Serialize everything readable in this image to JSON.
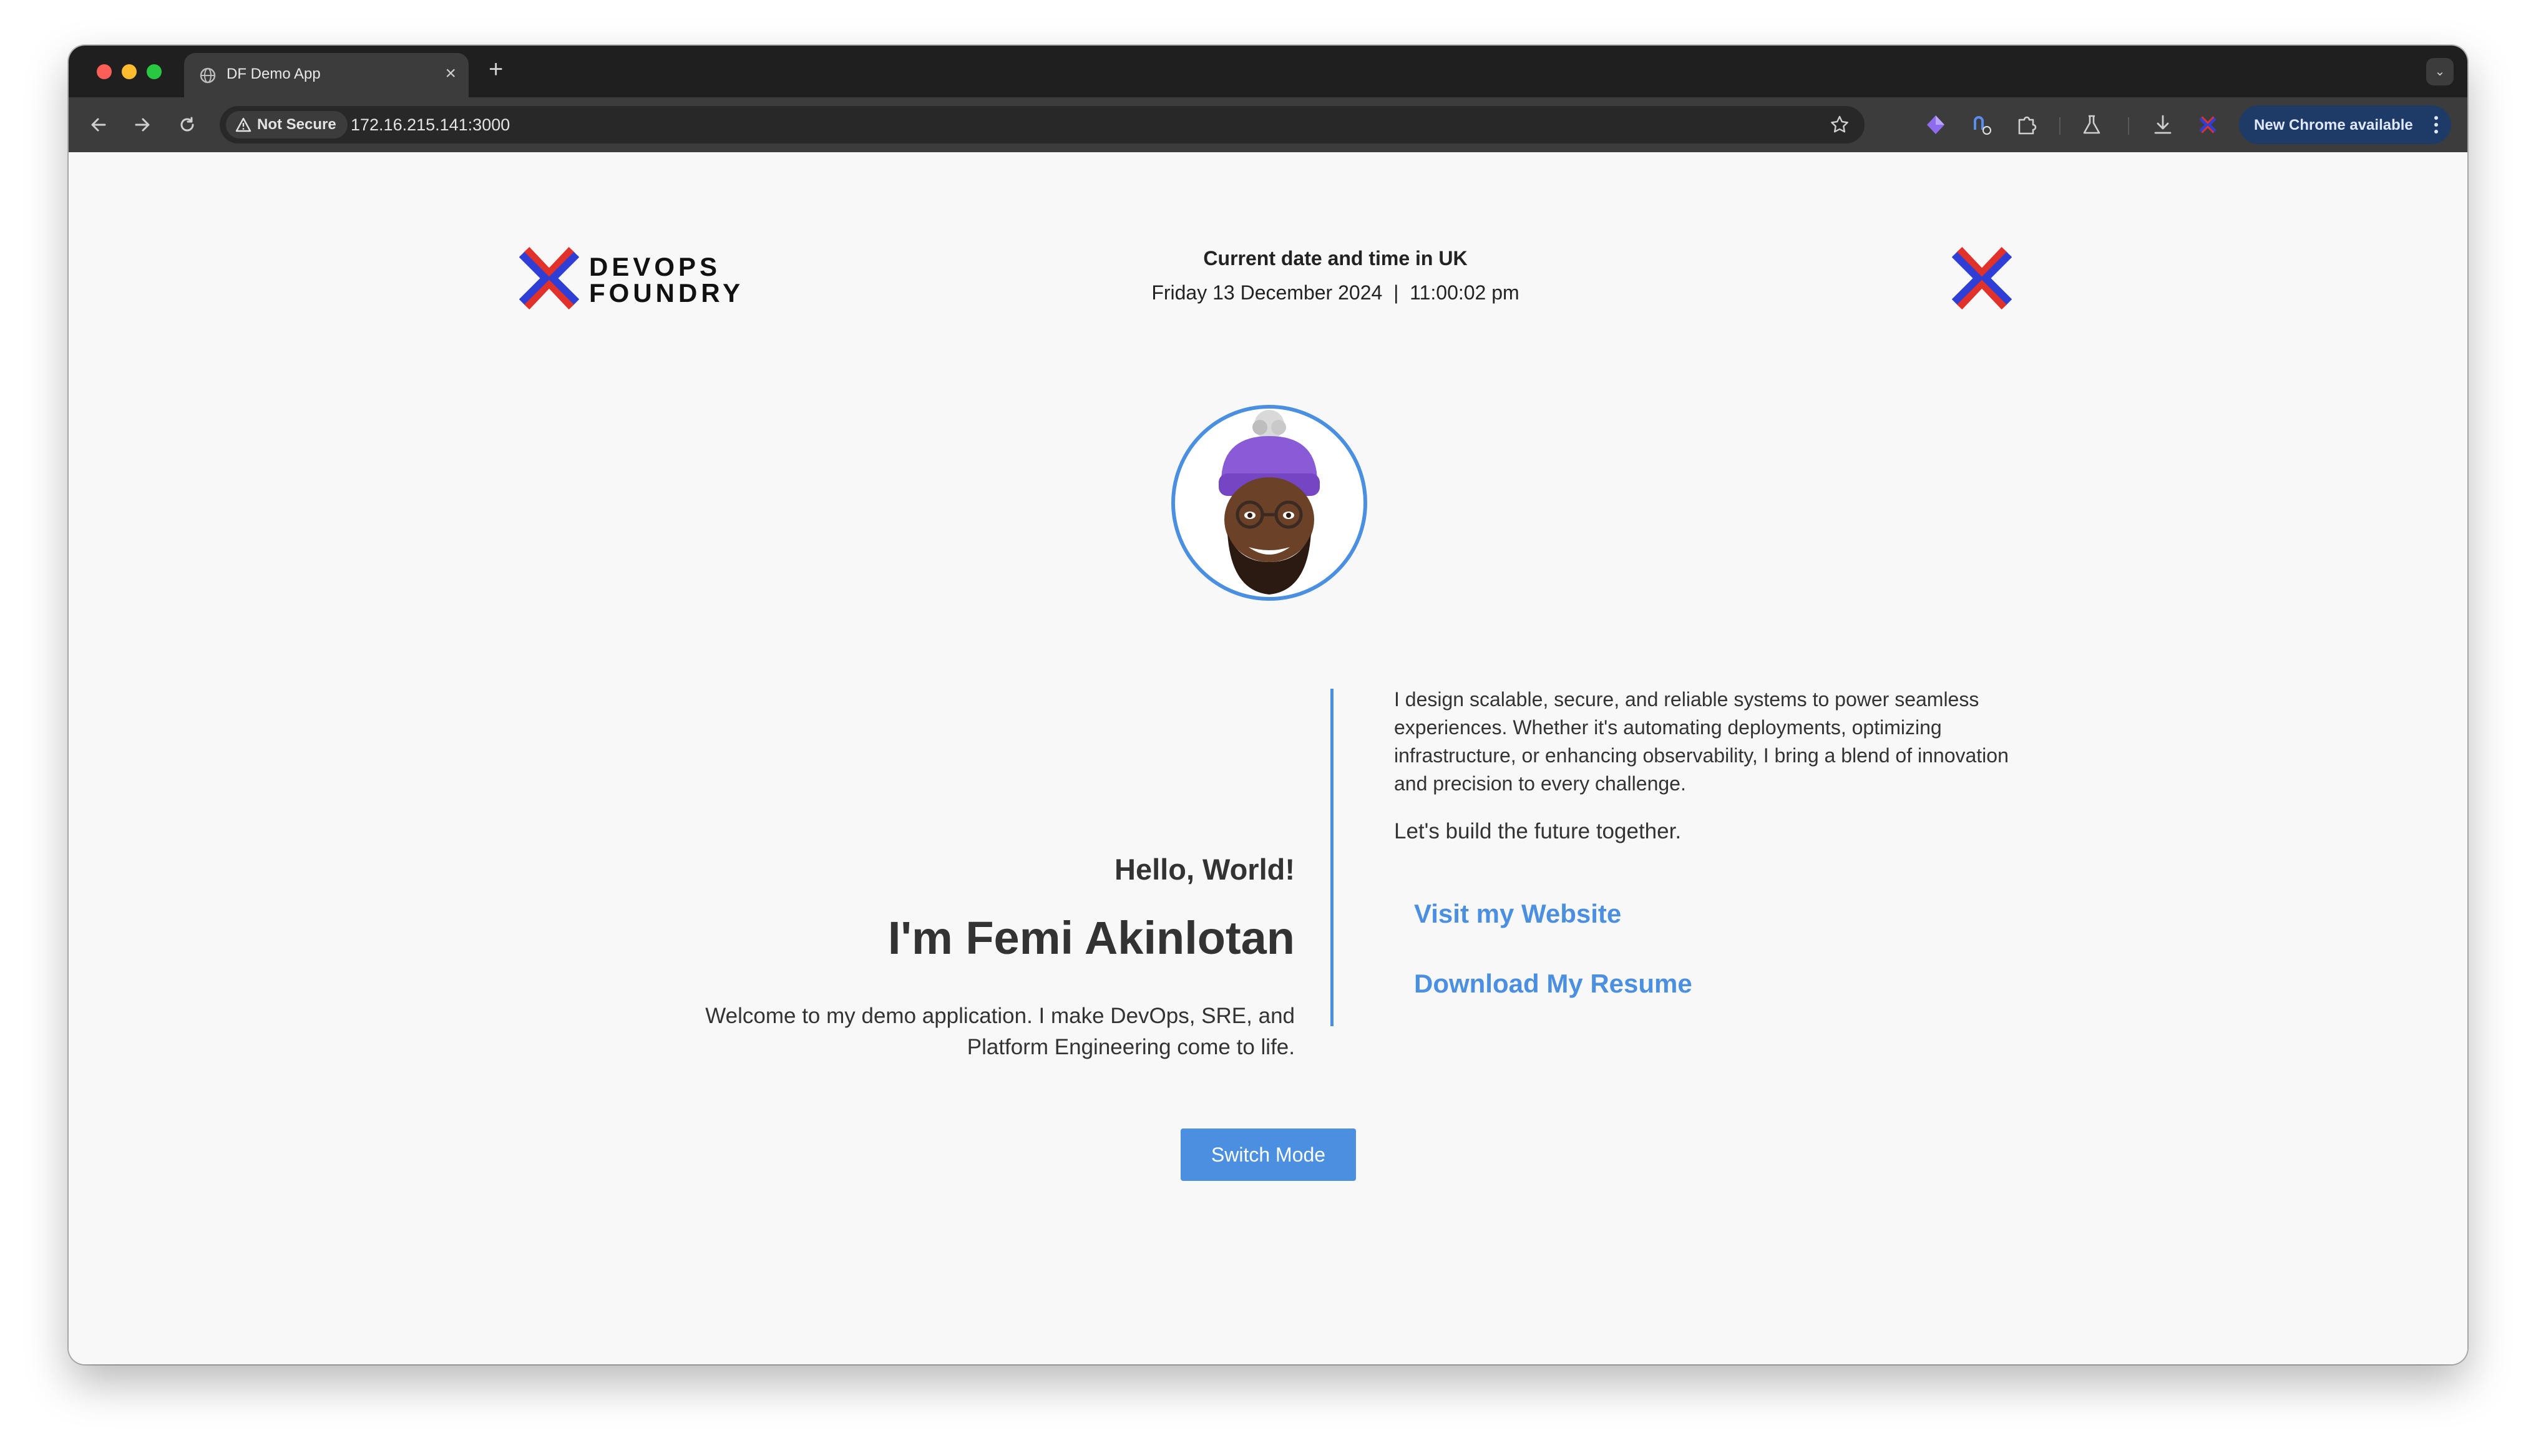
{
  "browser": {
    "tab_title": "DF Demo App",
    "tab_close": "×",
    "new_tab": "+",
    "tab_menu": "⌄",
    "security_label": "Not Secure",
    "url": "172.16.215.141:3000",
    "update_label": "New Chrome available",
    "icons": {
      "back": "back-arrow-icon",
      "forward": "forward-arrow-icon",
      "reload": "reload-icon",
      "bookmark": "star-icon",
      "downloads": "download-icon",
      "labs": "flask-icon",
      "extensions": "puzzle-icon"
    }
  },
  "header": {
    "logo_text_line1": "DEVOPS",
    "logo_text_line2": "FOUNDRY",
    "datetime_title": "Current date and time in UK",
    "date": "Friday 13 December 2024",
    "separator": "|",
    "time": "11:00:02 pm"
  },
  "hero": {
    "greeting": "Hello, World!",
    "name": "I'm Femi Akinlotan",
    "welcome": "Welcome to my demo application. I make DevOps, SRE, and Platform Engineering come to life.",
    "bio": "I design scalable, secure, and reliable systems to power seamless experiences. Whether it's automating deployments, optimizing infrastructure, or enhancing observability, I bring a blend of innovation and precision to every challenge.",
    "tagline": "Let's build the future together.",
    "website_link": "Visit my Website",
    "resume_link": "Download My Resume"
  },
  "actions": {
    "switch_mode": "Switch Mode"
  },
  "colors": {
    "accent": "#4a8fe0",
    "logo_red": "#e0312b",
    "logo_blue": "#2f3fd6",
    "page_bg": "#f8f8f8",
    "text": "#333333"
  }
}
